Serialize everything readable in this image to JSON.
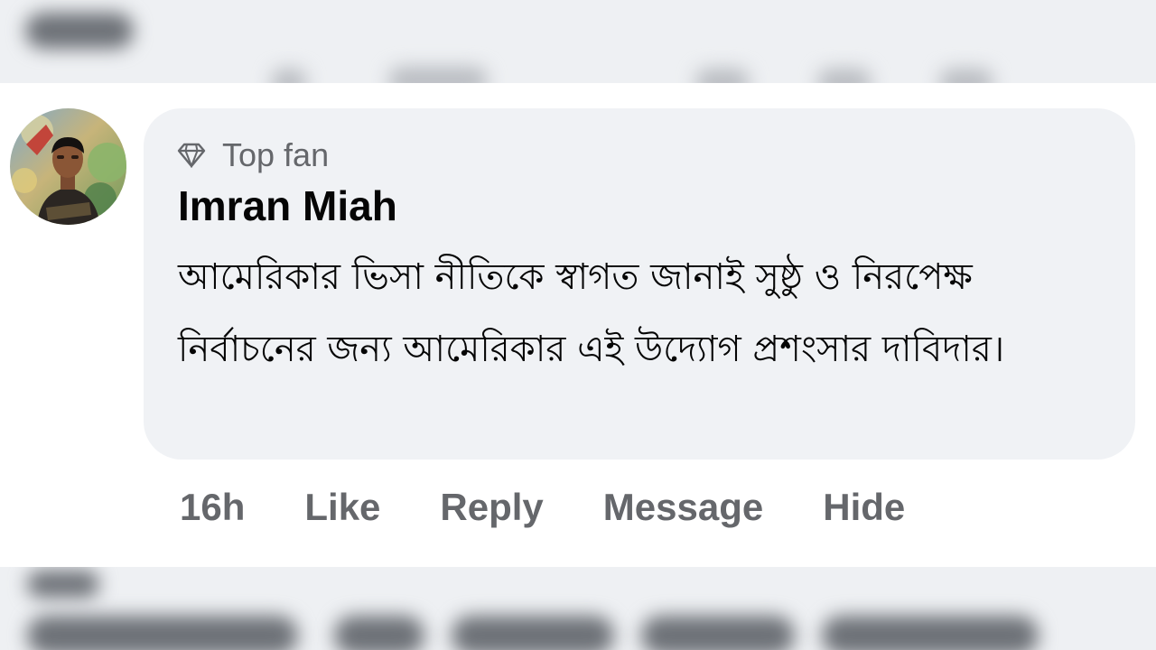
{
  "comment": {
    "badge": {
      "icon": "diamond-icon",
      "label": "Top fan"
    },
    "author": "Imran Miah",
    "avatar": {
      "icon": "profile-photo"
    },
    "text": "আমেরিকার ভিসা নীতিকে স্বাগত জানাই সুষ্ঠু ও নিরপেক্ষ নির্বাচনের জন্য আমেরিকার এই উদ্যোগ প্রশংসার দাবিদার।"
  },
  "actions": {
    "time": "16h",
    "like": "Like",
    "reply": "Reply",
    "message": "Message",
    "hide": "Hide"
  },
  "colors": {
    "bubble_background": "#f0f2f5",
    "secondary_text": "#65676b",
    "primary_text": "#050505"
  }
}
